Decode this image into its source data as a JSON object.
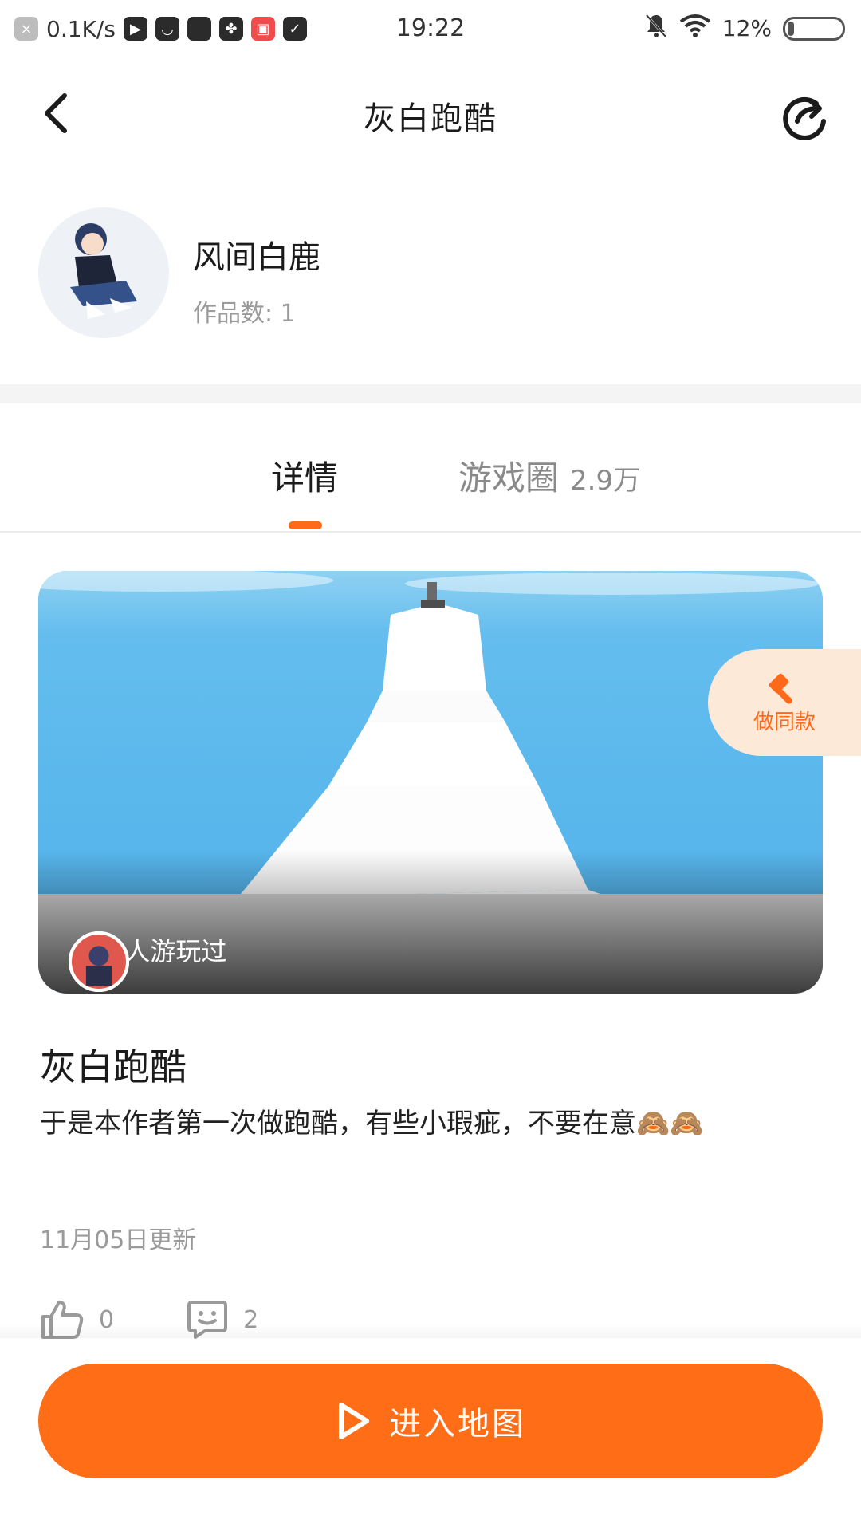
{
  "status_bar": {
    "net_speed": "0.1K/s",
    "time": "19:22",
    "battery": "12%",
    "battery_level": 0.12
  },
  "header": {
    "title": "灰白跑酷"
  },
  "author": {
    "name": "风间白鹿",
    "works": "作品数: 1"
  },
  "tabs": [
    {
      "label": "详情",
      "count": ""
    },
    {
      "label": "游戏圈",
      "count": "2.9万"
    }
  ],
  "hero": {
    "players_text": "1人游玩过"
  },
  "make_same": {
    "label": "做同款"
  },
  "game": {
    "title": "灰白跑酷",
    "description": "于是本作者第一次做跑酷，有些小瑕疵，不要在意🙈🙈",
    "updated": "11月05日更新"
  },
  "actions": {
    "likes": "0",
    "comments": "2"
  },
  "cta": {
    "label": "进入地图"
  },
  "colors": {
    "accent": "#ff6d17",
    "make_same_bg": "#fde9d8"
  }
}
